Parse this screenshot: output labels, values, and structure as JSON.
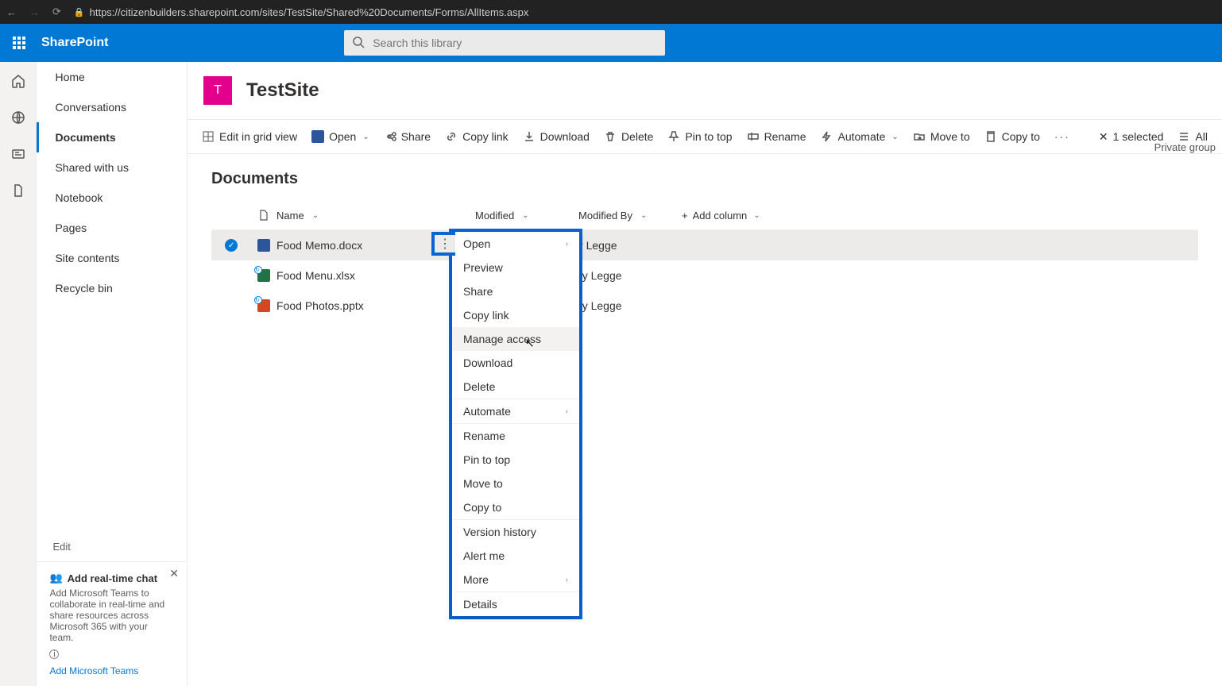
{
  "browser": {
    "url": "https://citizenbuilders.sharepoint.com/sites/TestSite/Shared%20Documents/Forms/AllItems.aspx"
  },
  "suite": {
    "brand": "SharePoint",
    "search_placeholder": "Search this library"
  },
  "site": {
    "logo_letter": "T",
    "title": "TestSite",
    "privacy": "Private group"
  },
  "nav": {
    "items": [
      "Home",
      "Conversations",
      "Documents",
      "Shared with us",
      "Notebook",
      "Pages",
      "Site contents",
      "Recycle bin"
    ],
    "active_index": 2,
    "edit": "Edit"
  },
  "teams_promo": {
    "title": "Add real-time chat",
    "body": "Add Microsoft Teams to collaborate in real-time and share resources across Microsoft 365 with your team.",
    "link": "Add Microsoft Teams"
  },
  "cmdbar": {
    "edit_grid": "Edit in grid view",
    "open": "Open",
    "share": "Share",
    "copy_link": "Copy link",
    "download": "Download",
    "delete": "Delete",
    "pin": "Pin to top",
    "rename": "Rename",
    "automate": "Automate",
    "move": "Move to",
    "copy_to": "Copy to",
    "selection": "1 selected",
    "all": "All"
  },
  "library": {
    "title": "Documents",
    "columns": {
      "name": "Name",
      "modified": "Modified",
      "modified_by": "Modified By",
      "add": "Add column"
    },
    "rows": [
      {
        "name": "Food Memo.docx",
        "type": "word",
        "modified_by": "ry Legge",
        "selected": true
      },
      {
        "name": "Food Menu.xlsx",
        "type": "excel",
        "modified_by": "ry Legge",
        "selected": false
      },
      {
        "name": "Food Photos.pptx",
        "type": "ppt",
        "modified_by": "ry Legge",
        "selected": false
      }
    ]
  },
  "context_menu": {
    "items": [
      {
        "label": "Open",
        "submenu": true
      },
      {
        "label": "Preview"
      },
      {
        "label": "Share"
      },
      {
        "label": "Copy link"
      },
      {
        "label": "Manage access",
        "hover": true
      },
      {
        "label": "Download"
      },
      {
        "label": "Delete",
        "sep_after": true
      },
      {
        "label": "Automate",
        "submenu": true,
        "sep_after": true
      },
      {
        "label": "Rename"
      },
      {
        "label": "Pin to top"
      },
      {
        "label": "Move to"
      },
      {
        "label": "Copy to",
        "sep_after": true
      },
      {
        "label": "Version history"
      },
      {
        "label": "Alert me"
      },
      {
        "label": "More",
        "submenu": true,
        "sep_after": true
      },
      {
        "label": "Details"
      }
    ]
  }
}
